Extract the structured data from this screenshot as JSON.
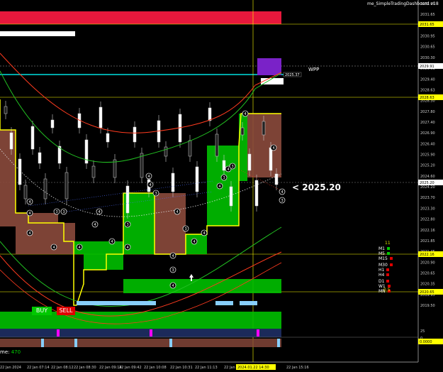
{
  "dashboard_title": "me_SimpleTradingDashboard v18",
  "big_price_text": "<  2025.20",
  "wpp_label": "WPP",
  "small_box_label": "2025.37",
  "buttons": {
    "buy": "BUY",
    "sell": "SELL"
  },
  "volume": {
    "label": "me:",
    "value": "470"
  },
  "timeframes": [
    {
      "name": "M1",
      "color": "#00c800"
    },
    {
      "name": "M5",
      "color": "#00c800"
    },
    {
      "name": "M15",
      "color": "#e00000"
    },
    {
      "name": "M30",
      "color": "#e00000"
    },
    {
      "name": "H1",
      "color": "#e00000"
    },
    {
      "name": "H4",
      "color": "#e00000"
    },
    {
      "name": "D1",
      "color": "#e00000"
    },
    {
      "name": "W1",
      "color": "#e00000"
    },
    {
      "name": "MN",
      "color": "#e00000"
    }
  ],
  "tf_top_value": "11",
  "tf_bottom_value": "0.5",
  "colors": {
    "bull_box": "#00c000",
    "bear_box": "#8b4a3c",
    "outline": "#ffff00",
    "bollinger": "#ff3b1f",
    "ma_green": "#22c022",
    "red_bar": "#e8183c",
    "cyan": "#00e0e0",
    "light_blue": "#87cefa",
    "indicator_bg": "#1c2a5a",
    "magenta": "#ff00ff"
  },
  "chart_data": {
    "type": "candlestick",
    "price_axis_labels": [
      "2032.00",
      "2031.65",
      "2031.20",
      "2030.95",
      "2030.65",
      "2030.30",
      "2029.91",
      "2029.40",
      "2028.63",
      "2028.30",
      "2027.80",
      "2027.40",
      "2026.90",
      "2026.40",
      "2025.90",
      "2025.20",
      "2024.60",
      "2024.20",
      "2023.70",
      "2023.30",
      "2022.80",
      "2022.16",
      "2021.85",
      "2021.45",
      "2020.90",
      "2020.65",
      "2020.35",
      "2019.95",
      "2019.50"
    ],
    "highlighted_prices": [
      {
        "value": "2031.65",
        "color": "#ffff00"
      },
      {
        "value": "2029.91",
        "color": "#ffffff"
      },
      {
        "value": "2028.63",
        "color": "#ffff00"
      },
      {
        "value": "2025.20",
        "color": "#ffffff"
      },
      {
        "value": "2022.16",
        "color": "#ffff00"
      },
      {
        "value": "2020.65",
        "color": "#ffff00"
      }
    ],
    "indicator_axis_labels": [
      "25",
      "0",
      "0.0000"
    ],
    "time_labels": [
      "22 Jan 2024",
      "22 Jan 07:14",
      "22 Jan 08:12",
      "22 Jan 08:30",
      "22 Jan 09:14",
      "22 Jan 09:42",
      "22 Jan 10:08",
      "22 Jan 10:31",
      "22 Jan 11:13",
      "22 Jan 12:40",
      "22 Jan 14:30",
      "22 Jan 15:16"
    ],
    "highlighted_time": "2024.01.22 14:30",
    "ma_markers": [
      "4",
      "4",
      "4",
      "3",
      "3",
      "4",
      "4",
      "4",
      "4",
      "3",
      "4",
      "4",
      "4",
      "3",
      "4",
      "3",
      "4",
      "4",
      "3",
      "4",
      "4",
      "4",
      "3",
      "4",
      "3",
      "4",
      "4",
      "4",
      "3",
      "4"
    ]
  }
}
